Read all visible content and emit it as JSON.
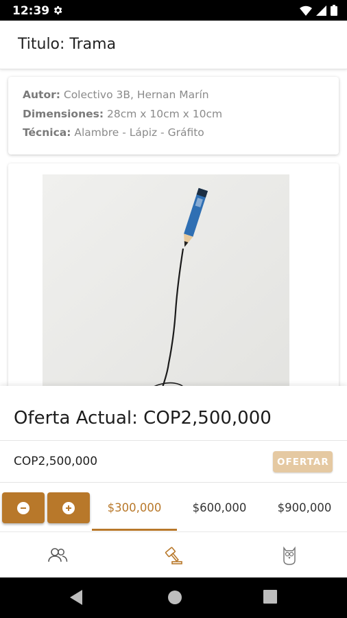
{
  "status_bar": {
    "time": "12:39",
    "icons": [
      "settings-icon",
      "wifi-icon",
      "signal-icon",
      "battery-icon"
    ]
  },
  "header": {
    "title": "Titulo: Trama"
  },
  "details": {
    "author_label": "Autor:",
    "author_value": "Colectivo 3B, Hernan Marín",
    "dimensions_label": "Dimensiones:",
    "dimensions_value": "28cm x 10cm x 10cm",
    "technique_label": "Técnica:",
    "technique_value": "Alambre - Lápiz - Gráfito"
  },
  "artwork": {
    "image_icon": "pencil-sculpture-image"
  },
  "bid": {
    "current_offer": "Oferta Actual: COP2,500,000",
    "amount": "COP2,500,000",
    "offer_button": "OFERTAR",
    "decrement_icon": "minus-icon",
    "increment_icon": "plus-icon",
    "increments": [
      {
        "label": "$300,000",
        "active": true
      },
      {
        "label": "$600,000",
        "active": false
      },
      {
        "label": "$900,000",
        "active": false
      }
    ]
  },
  "bottom_nav": {
    "items": [
      {
        "icon": "people-icon",
        "active": false
      },
      {
        "icon": "auction-gavel-icon",
        "active": true
      },
      {
        "icon": "owl-icon",
        "active": false
      }
    ]
  },
  "system_nav": [
    "back-icon",
    "home-icon",
    "recents-icon"
  ],
  "colors": {
    "accent": "#b8782a",
    "offer_button": "#e5c9a2",
    "status_bar": "#000000"
  }
}
